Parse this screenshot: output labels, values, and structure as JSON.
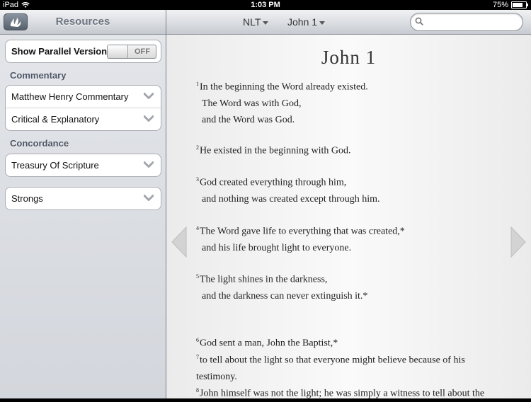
{
  "status": {
    "carrier": "iPad",
    "time": "1:03 PM",
    "battery": "75%",
    "battery_level": 0.75
  },
  "sidebar": {
    "title": "Resources",
    "parallel": {
      "label": "Show Parallel Version",
      "toggle": "OFF"
    },
    "commentary_header": "Commentary",
    "commentary": [
      "Matthew Henry Commentary",
      "Critical & Explanatory"
    ],
    "concordance_header": "Concordance",
    "concordance": [
      "Treasury Of Scripture"
    ],
    "strongs": "Strongs"
  },
  "toolbar": {
    "version": "NLT",
    "chapter": "John 1",
    "search_placeholder": ""
  },
  "content": {
    "title": "John 1",
    "verses": [
      {
        "n": "1",
        "lines": [
          "In the beginning the Word already existed.",
          "The Word was with God,",
          "and the Word was God."
        ]
      },
      {
        "n": "2",
        "lines": [
          "He existed in the beginning with God."
        ]
      },
      {
        "n": "3",
        "lines": [
          "God created everything through him,",
          "and nothing was created except through him."
        ]
      },
      {
        "n": "4",
        "lines": [
          "The Word gave life to everything that was created,*",
          "and his life brought light to everyone."
        ]
      },
      {
        "n": "5",
        "lines": [
          "The light shines in the darkness,",
          "and the darkness can never extinguish it.*"
        ]
      },
      {
        "n": "6",
        "lines": [
          "God sent a man, John the Baptist,*"
        ]
      },
      {
        "n": "7",
        "lines": [
          "to tell about the light so that everyone might believe because of his",
          "testimony."
        ]
      },
      {
        "n": "8",
        "lines": [
          "John himself was not the light; he was simply a witness to tell about the"
        ]
      }
    ]
  }
}
